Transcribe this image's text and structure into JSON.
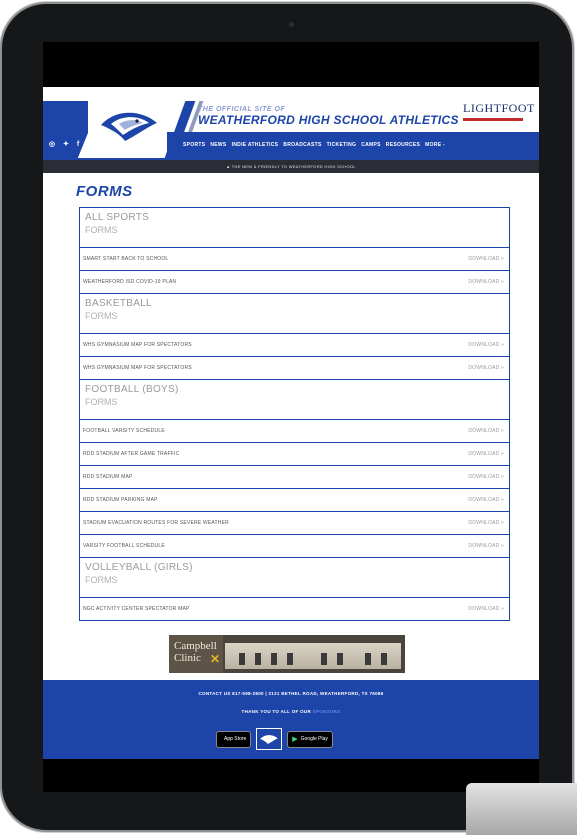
{
  "header": {
    "site_small": "THE OFFICIAL SITE OF",
    "site_title": "WEATHERFORD HIGH SCHOOL ATHLETICS",
    "social_icons": "◎ ✦ f",
    "sponsor": {
      "name": "LIGHTFOOT",
      "sub": ""
    },
    "nav": [
      "SPORTS",
      "NEWS",
      "INDIE ATHLETICS",
      "BROADCASTS",
      "TICKETING",
      "CAMPS",
      "RESOURCES",
      "MORE -"
    ],
    "banner": "▲ THE NEW & FRIENDLY TO WEATHERFORD HIGH SCHOOL"
  },
  "page": {
    "title": "FORMS"
  },
  "sections": [
    {
      "sport": "ALL SPORTS",
      "sub": "FORMS",
      "rows": [
        {
          "name": "SMART START BACK TO SCHOOL",
          "action": "DOWNLOAD »"
        },
        {
          "name": "WEATHERFORD ISD COVID-19 PLAN",
          "action": "DOWNLOAD »"
        }
      ]
    },
    {
      "sport": "BASKETBALL",
      "sub": "FORMS",
      "rows": [
        {
          "name": "WHS GYMNASIUM MAP FOR SPECTATORS",
          "action": "DOWNLOAD »"
        },
        {
          "name": "WHS GYMNASIUM MAP FOR SPECTATORS",
          "action": "DOWNLOAD »"
        }
      ]
    },
    {
      "sport": "FOOTBALL (BOYS)",
      "sub": "FORMS",
      "rows": [
        {
          "name": "FOOTBALL VARSITY SCHEDULE",
          "action": "DOWNLOAD »"
        },
        {
          "name": "RDD STADIUM AFTER GAME TRAFFIC",
          "action": "DOWNLOAD »"
        },
        {
          "name": "RDD STADIUM MAP",
          "action": "DOWNLOAD »"
        },
        {
          "name": "RDD STADIUM PARKING MAP",
          "action": "DOWNLOAD »"
        },
        {
          "name": "STADIUM EVACUATION ROUTES FOR SEVERE WEATHER",
          "action": "DOWNLOAD »"
        },
        {
          "name": "VARSITY FOOTBALL SCHEDULE",
          "action": "DOWNLOAD »"
        }
      ]
    },
    {
      "sport": "VOLLEYBALL (GIRLS)",
      "sub": "FORMS",
      "rows": [
        {
          "name": "NGC ACTIVITY CENTER SPECTATOR MAP",
          "action": "DOWNLOAD »"
        }
      ]
    }
  ],
  "ad": {
    "line1": "Campbell",
    "line2": "Clinic",
    "mark": "✕"
  },
  "footer": {
    "contact": "CONTACT US 817-598-2800 | 2121 BETHEL ROAD, WEATHERFORD, TX 76086",
    "thanks": "THANK YOU TO ALL OF OUR",
    "thanks_link": "SPONSORS",
    "app_store": "App Store",
    "app_store_icon": "",
    "google_play": "Google Play",
    "google_play_icon": "▶"
  },
  "colors": {
    "brand_blue": "#1d44a8",
    "banner_dark": "#2a2d36",
    "device": "#161718"
  }
}
